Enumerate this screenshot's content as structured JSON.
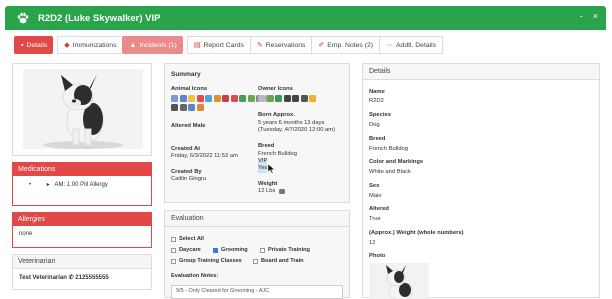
{
  "window": {
    "title": "R2D2 (Luke Skywalker) VIP",
    "minimize_label": "-",
    "close_label": "×"
  },
  "tabs": [
    {
      "label": "Details",
      "icon": "info-icon",
      "style": "red"
    },
    {
      "label": "Immunizations",
      "icon": "shield-icon",
      "style": "dark"
    },
    {
      "label": "Incidents (1)",
      "icon": "warning-icon",
      "style": "pink"
    },
    {
      "label": "Report Cards",
      "icon": "report-icon",
      "style": "dark"
    },
    {
      "label": "Reservations",
      "icon": "edit-icon",
      "style": "dark"
    },
    {
      "label": "Emp. Notes (2)",
      "icon": "pencil-icon",
      "style": "dark"
    },
    {
      "label": "Addtl. Details",
      "icon": "more-icon",
      "style": "dark"
    }
  ],
  "left": {
    "medications": {
      "title": "Medications",
      "item": "AM: 1.00 Pill Allergy"
    },
    "allergies": {
      "title": "Allergies",
      "value": "none"
    },
    "veterinarian": {
      "title": "Veterinarian",
      "name": "Test Veterinarian",
      "phone": "2125555555"
    }
  },
  "summary": {
    "title": "Summary",
    "animal_icons_label": "Animal Icons",
    "owner_icons_label": "Owner Icons",
    "altered_value": "Altered Male",
    "born_label": "Born Approx.",
    "born_age": "5 years 6 months 13 days",
    "born_date": "(Tuesday, 4/7/2020 12:00 am)",
    "created_at_label": "Created At",
    "created_at_value": "Friday, 6/3/2022 11:53 am",
    "breed_label": "Breed",
    "breed_value": "French Bulldog",
    "breed_vip": "VIP",
    "breed_yes": "Yes",
    "created_by_label": "Created By",
    "created_by_value": "Caitlin Gingru",
    "weight_label": "Weight",
    "weight_value": "12 Lbs"
  },
  "evaluation": {
    "title": "Evaluation",
    "select_all": "Select All",
    "options": [
      {
        "label": "Daycare",
        "checked": false
      },
      {
        "label": "Grooming",
        "checked": true
      },
      {
        "label": "Private Training",
        "checked": false
      },
      {
        "label": "Group Training Classes",
        "checked": false
      },
      {
        "label": "Board and Train",
        "checked": false
      }
    ],
    "notes_label": "Evaluation Notes:",
    "notes_value": "9/5 - Only Cleared for Grooming - AJC"
  },
  "details": {
    "title": "Details",
    "name_label": "Name",
    "name_value": "R2D2",
    "species_label": "Species",
    "species_value": "Dog",
    "breed_label": "Breed",
    "breed_value": "French Bulldog",
    "color_label": "Color and Markings",
    "color_value": "White and Black",
    "sex_label": "Sex",
    "sex_value": "Male",
    "altered_label": "Altered",
    "altered_value": "True",
    "weight_label": "(Approx.) Weight (whole numbers)",
    "weight_value": "12",
    "photo_label": "Photo"
  }
}
